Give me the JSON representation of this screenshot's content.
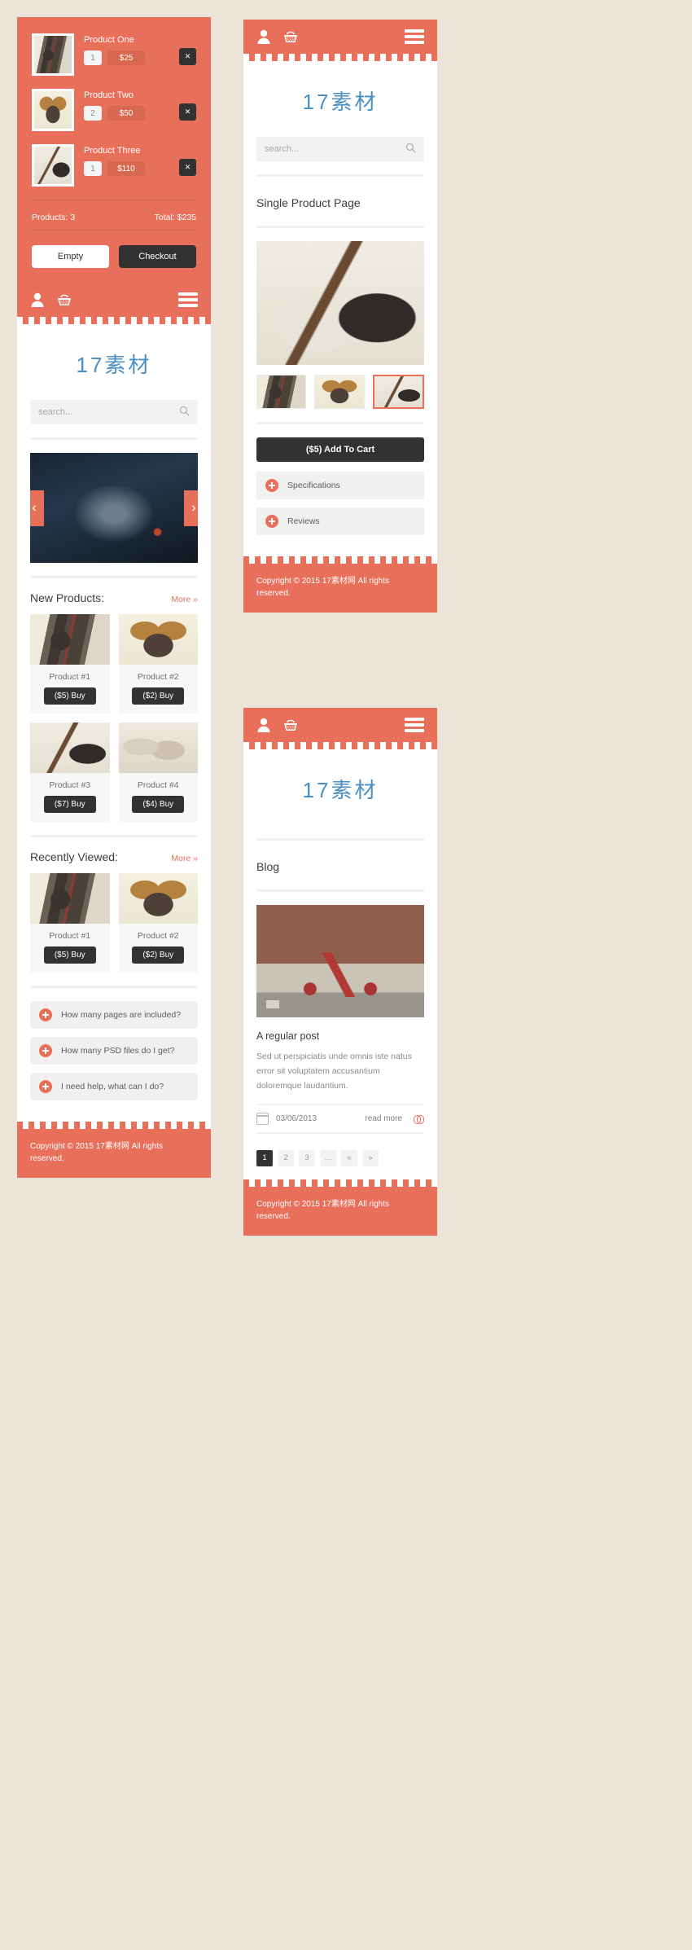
{
  "brand": {
    "logo": "17素材",
    "accent": "#e8705a",
    "dark": "#333233",
    "logo_color": "#4a90c4"
  },
  "cart": {
    "items": [
      {
        "name": "Product One",
        "qty": "1",
        "price": "$25",
        "remove": "✕",
        "image": "camera-lens-mug"
      },
      {
        "name": "Product Two",
        "qty": "2",
        "price": "$50",
        "remove": "✕",
        "image": "sunglasses"
      },
      {
        "name": "Product Three",
        "qty": "1",
        "price": "$110",
        "remove": "✕",
        "image": "coffee-pot"
      }
    ],
    "products_label": "Products: 3",
    "total_label": "Total: $235",
    "empty_button": "Empty",
    "checkout_button": "Checkout"
  },
  "navbar": {
    "user_icon": "user-icon",
    "basket_icon": "basket-icon",
    "menu_icon": "hamburger-menu-icon"
  },
  "search": {
    "placeholder": "search...",
    "value": "",
    "icon": "search-icon"
  },
  "home": {
    "carousel": {
      "prev": "‹",
      "next": "›",
      "image": "dark-tech-product"
    },
    "new_products": {
      "title": "New Products:",
      "more": "More »",
      "items": [
        {
          "name": "Product #1",
          "buy": "($5) Buy",
          "image": "camera-lens-mug"
        },
        {
          "name": "Product #2",
          "buy": "($2) Buy",
          "image": "sunglasses"
        },
        {
          "name": "Product #3",
          "buy": "($7) Buy",
          "image": "coffee-pot"
        },
        {
          "name": "Product #4",
          "buy": "($4) Buy",
          "image": "shells"
        }
      ]
    },
    "recently_viewed": {
      "title": "Recently Viewed:",
      "more": "More »",
      "items": [
        {
          "name": "Product #1",
          "buy": "($5) Buy",
          "image": "camera-lens-mug"
        },
        {
          "name": "Product #2",
          "buy": "($2) Buy",
          "image": "sunglasses"
        }
      ]
    },
    "faq": [
      {
        "label": "How many pages are included?",
        "icon": "plus-icon"
      },
      {
        "label": "How many PSD files do I get?",
        "icon": "plus-icon"
      },
      {
        "label": "I need help, what can I do?",
        "icon": "plus-icon"
      }
    ]
  },
  "product_page": {
    "title": "Single Product Page",
    "hero_image": "coffee-pot",
    "thumbs": [
      {
        "image": "camera-lens-mug",
        "active": false
      },
      {
        "image": "sunglasses",
        "active": false
      },
      {
        "image": "coffee-pot",
        "active": true
      }
    ],
    "add_to_cart": "($5) Add To Cart",
    "tabs": [
      {
        "label": "Specifications",
        "icon": "plus-icon"
      },
      {
        "label": "Reviews",
        "icon": "plus-icon"
      }
    ]
  },
  "blog_page": {
    "title": "Blog",
    "post": {
      "image": "bicycle-wall",
      "title": "A regular post",
      "body": "Sed ut perspiciatis unde omnis iste natus error sit voluptatem accusantium doloremque laudantium.",
      "date": "03/06/2013",
      "date_icon": "calendar-icon",
      "read_more": "read more",
      "read_more_icon": "link-icon"
    },
    "pagination": [
      {
        "label": "1",
        "active": true
      },
      {
        "label": "2",
        "active": false
      },
      {
        "label": "3",
        "active": false
      },
      {
        "label": "…",
        "active": false
      },
      {
        "label": "«",
        "active": false
      },
      {
        "label": "»",
        "active": false
      }
    ]
  },
  "footer": {
    "text": "Copyright © 2015 17素材网 All rights reserved."
  }
}
